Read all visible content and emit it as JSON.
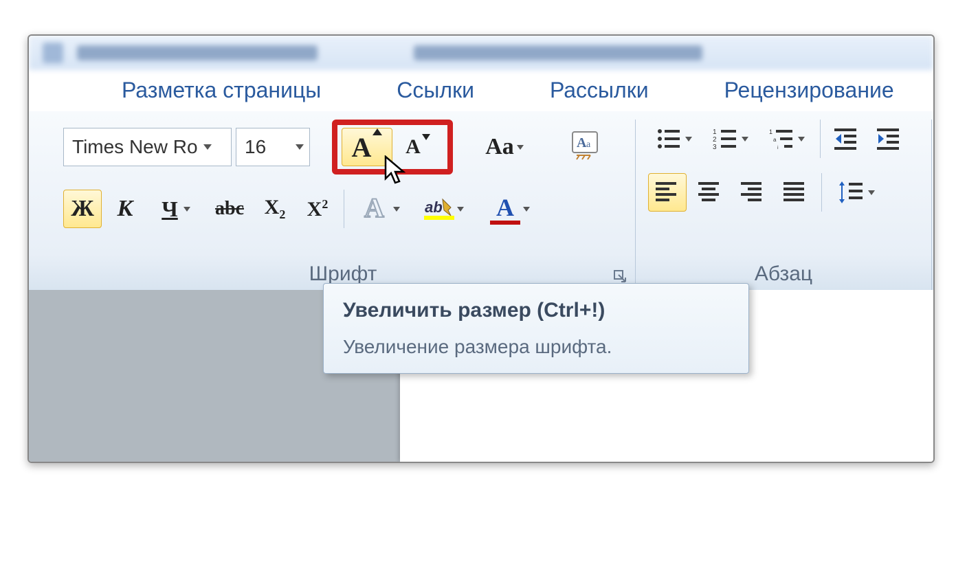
{
  "menubar": {
    "tabs": [
      "Разметка страницы",
      "Ссылки",
      "Рассылки",
      "Рецензирование"
    ]
  },
  "font_group": {
    "label": "Шрифт",
    "font_name": "Times New Ro",
    "font_size": "16",
    "bold": "Ж",
    "italic": "К",
    "underline": "Ч",
    "strike": "abc",
    "subscript": "X",
    "subscript_sub": "2",
    "superscript": "X",
    "superscript_sup": "2",
    "grow_font": "A",
    "shrink_font": "A",
    "change_case": "Aa",
    "clear_format": "A",
    "text_fill": "A",
    "highlight": "ab",
    "font_color": "A"
  },
  "paragraph_group": {
    "label": "Абзац"
  },
  "tooltip": {
    "title": "Увеличить размер (Ctrl+!)",
    "desc": "Увеличение размера шрифта."
  }
}
